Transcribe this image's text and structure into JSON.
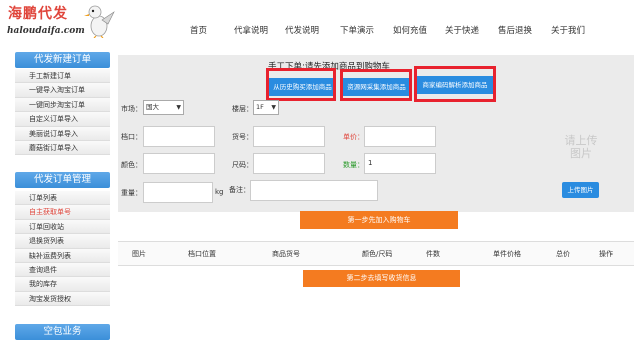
{
  "logo": {
    "title": "海鹏代发",
    "url": "haloudaifa.com"
  },
  "nav": [
    "首页",
    "代拿说明",
    "代发说明",
    "下单演示",
    "如何充值",
    "关于快递",
    "售后退换",
    "关于我们"
  ],
  "sidebar": {
    "sections": [
      {
        "title": "代发新建订单",
        "items": [
          "手工新建订单",
          "一键导入淘宝订单",
          "一键同步淘宝订单",
          "自定义订单导入",
          "美丽说订单导入",
          "蘑菇街订单导入"
        ]
      },
      {
        "title": "代发订单管理",
        "items": [
          "订单列表",
          "自主获取单号",
          "订单回收站",
          "退换货列表",
          "缺补运费列表",
          "查询退件",
          "我的库存",
          "淘宝发货授权"
        ]
      },
      {
        "title": "空包业务",
        "items": []
      }
    ]
  },
  "main": {
    "title": "手工下单:请先添加商品到购物车",
    "tabs": [
      "从历史购买添加商品",
      "资源网采集添加商品",
      "商家编码解析添加商品"
    ],
    "form": {
      "market_label": "市场：",
      "market_value": "国大",
      "floor_label": "楼层：",
      "floor_value": "1F",
      "stall_label": "档口：",
      "stall_value": "",
      "item_no_label": "货号：",
      "item_no_value": "",
      "price_label": "单价：",
      "price_value": "",
      "color_label": "颜色：",
      "color_value": "",
      "size_label": "尺码：",
      "size_value": "",
      "qty_label": "数量：",
      "qty_value": "1",
      "weight_label": "重量：",
      "weight_value": "",
      "weight_unit": "kg",
      "remark_label": "备注：",
      "remark_value": ""
    },
    "image_placeholder": "请上传图片",
    "upload_label": "上传图片",
    "step1_label": "第一步先加入购物车",
    "table_headers": [
      "图片",
      "档口位置",
      "商品货号",
      "颜色/尺码",
      "件数",
      "单件价格",
      "总价",
      "操作"
    ],
    "step2_label": "第二步去填写收货信息"
  },
  "colors": {
    "accent": "#2a8ce0",
    "orange": "#f47b20",
    "highlight": "#e8222e"
  }
}
